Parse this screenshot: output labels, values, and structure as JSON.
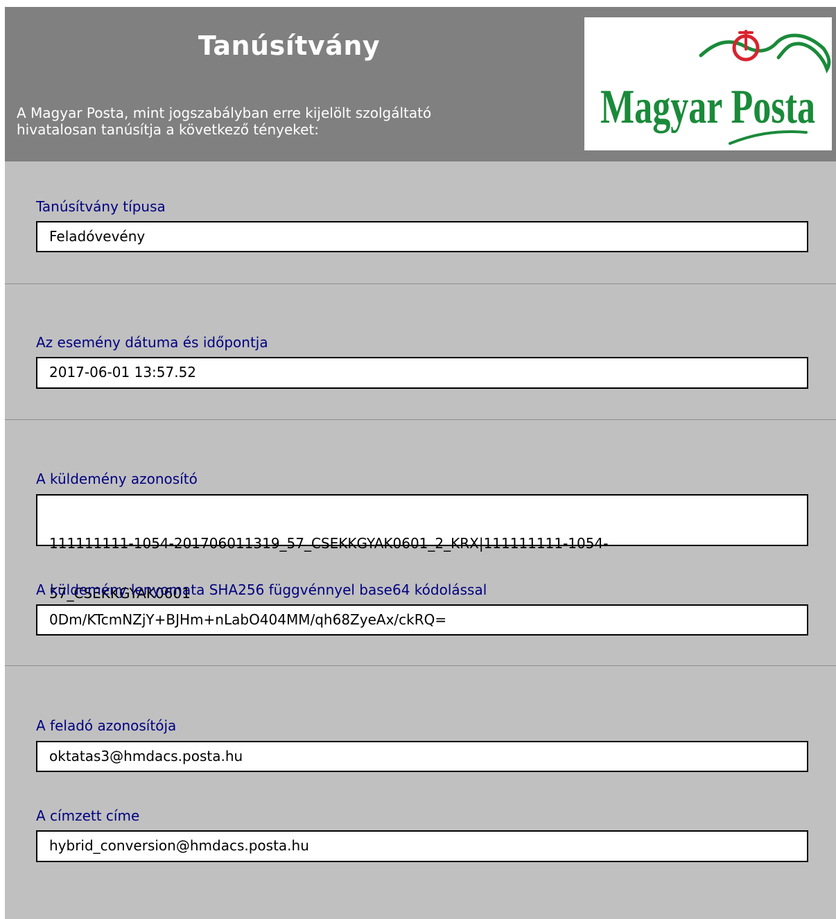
{
  "header": {
    "title": "Tanúsítvány",
    "intro_line1": "A Magyar Posta, mint jogszabályban erre kijelölt szolgáltató",
    "intro_line2": "hivatalosan tanúsítja a következő tényeket:",
    "logo_text": "Magyar Posta"
  },
  "fields": {
    "type": {
      "label": "Tanúsítvány típusa",
      "value": "Feladóvevény"
    },
    "datetime": {
      "label": "Az esemény dátuma és időpontja",
      "value": "2017-06-01 13:57.52"
    },
    "shipment_id": {
      "label": "A küldemény azonosító",
      "value_line1": "111111111-1054-201706011319_57_CSEKKGYAK0601_2_KRX|111111111-1054-",
      "value_line2": "57_CSEKKGYAK0601"
    },
    "hash": {
      "label": "A küldemény lenyomata SHA256 függvénnyel base64 kódolással",
      "value": "0Dm/KTcmNZjY+BJHm+nLabO404MM/qh68ZyeAx/ckRQ="
    },
    "sender": {
      "label": "A feladó azonosítója",
      "value": "oktatas3@hmdacs.posta.hu"
    },
    "recipient": {
      "label": "A címzett címe",
      "value": "hybrid_conversion@hmdacs.posta.hu"
    }
  },
  "colors": {
    "header_bg": "#808080",
    "page_bg": "#c0c0c0",
    "label_color": "#000080",
    "logo_green": "#1a8a3a",
    "logo_red": "#d9232e"
  },
  "icons": {
    "logo": "magyar-posta-logo"
  }
}
